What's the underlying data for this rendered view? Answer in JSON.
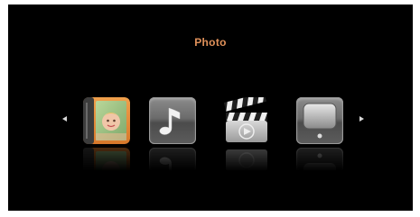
{
  "menu": {
    "title": "Photo",
    "title_color": "#e0915a",
    "items": [
      {
        "name": "photo",
        "icon": "photo-album-icon",
        "selected": true
      },
      {
        "name": "music",
        "icon": "music-note-icon",
        "selected": false
      },
      {
        "name": "movie",
        "icon": "clapperboard-icon",
        "selected": false
      },
      {
        "name": "tv",
        "icon": "television-icon",
        "selected": false
      }
    ]
  },
  "nav": {
    "left_icon": "arrow-left-icon",
    "right_icon": "arrow-right-icon"
  }
}
